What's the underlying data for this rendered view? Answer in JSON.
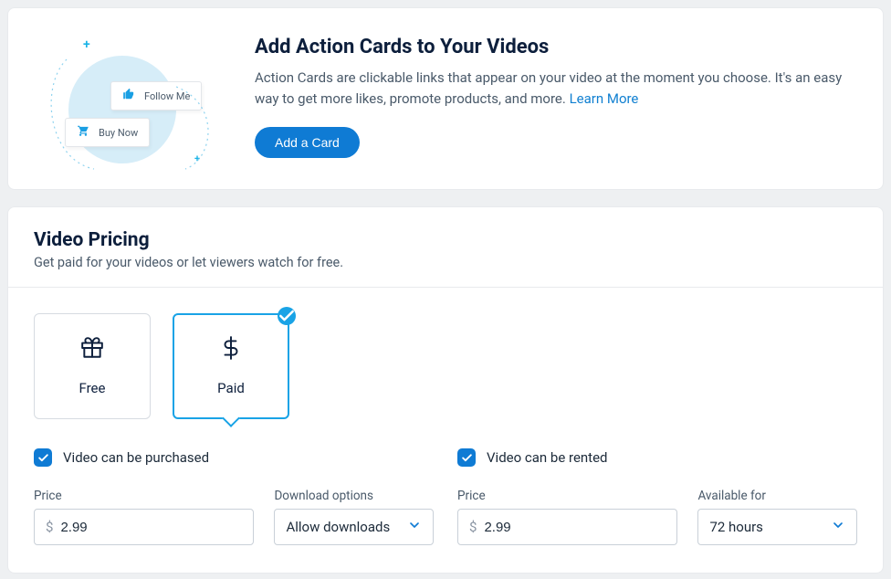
{
  "action_cards": {
    "title": "Add Action Cards to Your Videos",
    "description": "Action Cards are clickable links that appear on your video at the moment you choose. It's an easy way to get more likes, promote products, and more. ",
    "learn_more": "Learn More",
    "button": "Add a Card",
    "illus_card1": "Follow Me",
    "illus_card2": "Buy Now"
  },
  "pricing": {
    "title": "Video Pricing",
    "subtitle": "Get paid for your videos or let viewers watch for free.",
    "tiles": {
      "free": "Free",
      "paid": "Paid"
    },
    "purchase": {
      "checkbox": "Video can be purchased",
      "price_label": "Price",
      "price_value": "2.99",
      "price_prefix": "$",
      "download_label": "Download options",
      "download_value": "Allow downloads"
    },
    "rent": {
      "checkbox": "Video can be rented",
      "price_label": "Price",
      "price_value": "2.99",
      "price_prefix": "$",
      "available_label": "Available for",
      "available_value": "72 hours"
    }
  }
}
